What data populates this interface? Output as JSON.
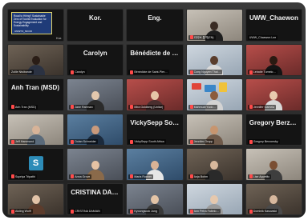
{
  "meeting": {
    "tiles": [
      {
        "id": "shared-slide",
        "label": "",
        "slide_text": "Road to Hiring? Sustainable Zero of Tourist Evaluation for Energy Engagement and Sustainability",
        "slide_footer": "UNWTO_MCCD",
        "side_tag": "Kor."
      },
      {
        "id": "kor",
        "big": "Kor.",
        "label": ""
      },
      {
        "id": "eng",
        "big": "Eng.",
        "label": ""
      },
      {
        "id": "cam-korean",
        "label": "라이브 통역(EN)"
      },
      {
        "id": "uww",
        "big": "UWW_Chaewon",
        "label": "UWW_Chaewon Lee"
      },
      {
        "id": "zolile",
        "label": "Zolile Ntsibande"
      },
      {
        "id": "carolyn",
        "big": "Carolyn",
        "label": "Carolyn"
      },
      {
        "id": "benedicte",
        "big": "Bénédicte de Sa…",
        "label": "Bénédicte de Saint-Pier…"
      },
      {
        "id": "cam-nguyen",
        "label": "Cong Nguyen Thai…"
      },
      {
        "id": "cam-tumi",
        "label": "Lebatle Tumelo…"
      },
      {
        "id": "anh",
        "big": "Anh Tran (MSD)",
        "label": "Anh Tran (MSD)"
      },
      {
        "id": "cam-jane",
        "label": "Jane Rahman"
      },
      {
        "id": "cam-mira",
        "label": "Mira Goldberg (Unitar)"
      },
      {
        "id": "cam-mahmudi",
        "label": "Mahmudi Yudo…"
      },
      {
        "id": "cam-jennifer-c",
        "label": "Jennifer Gamela"
      },
      {
        "id": "cam-jeff",
        "label": "Jeff Hammond"
      },
      {
        "id": "cam-doran",
        "label": "Dolan Schneider"
      },
      {
        "id": "vicky",
        "big": "VickySepp South…",
        "label": "VickySepp South Africa"
      },
      {
        "id": "cam-jennifer-o",
        "label": "Jennifer Oropp"
      },
      {
        "id": "gregory",
        "big": "Gregory Berzon…",
        "label": "Gregory Berzonsky"
      },
      {
        "id": "supriya",
        "avatar": "S",
        "label": "Supriya Tripathi"
      },
      {
        "id": "cam-anna",
        "label": "Anna Grove"
      },
      {
        "id": "cam-maria",
        "label": "Maria Ronner"
      },
      {
        "id": "cam-anja",
        "label": "Anja Bohm"
      },
      {
        "id": "cam-lise",
        "label": "Lise Appetito"
      },
      {
        "id": "cam-aisling",
        "label": "Aisling Wolff"
      },
      {
        "id": "cristina",
        "big": "CRISTINA DAMI…",
        "label": "CRISTINA DAMIAN"
      },
      {
        "id": "cam-kyoungsook",
        "label": "Kyoungsook Jung"
      },
      {
        "id": "cam-ann",
        "label": "Ann Petra Falbrio…"
      },
      {
        "id": "cam-dominik",
        "label": "Dominik Kasowski"
      }
    ]
  }
}
